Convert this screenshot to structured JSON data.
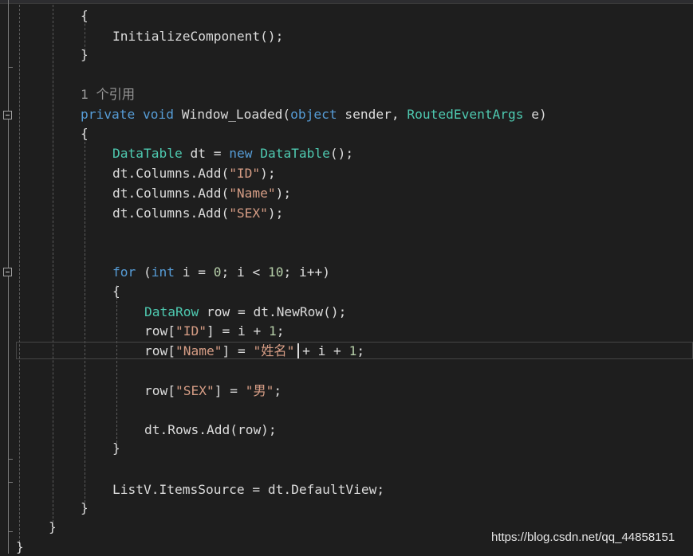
{
  "editor": {
    "lines": [
      {
        "id": "l1",
        "tokens": [
          {
            "t": "{",
            "c": "pl"
          }
        ]
      },
      {
        "id": "l2",
        "tokens": [
          {
            "t": "InitializeComponent();",
            "c": "pl"
          }
        ]
      },
      {
        "id": "l3",
        "tokens": [
          {
            "t": "}",
            "c": "pl"
          }
        ]
      },
      {
        "id": "ref",
        "tokens": [
          {
            "t": "1 个引用",
            "c": "rf"
          }
        ]
      },
      {
        "id": "l5",
        "tokens": [
          {
            "t": "private",
            "c": "kw"
          },
          {
            "t": " ",
            "c": "pl"
          },
          {
            "t": "void",
            "c": "kw"
          },
          {
            "t": " Window_Loaded(",
            "c": "pl"
          },
          {
            "t": "object",
            "c": "kw"
          },
          {
            "t": " sender, ",
            "c": "pl"
          },
          {
            "t": "RoutedEventArgs",
            "c": "ty"
          },
          {
            "t": " e)",
            "c": "pl"
          }
        ]
      },
      {
        "id": "l6",
        "tokens": [
          {
            "t": "{",
            "c": "pl"
          }
        ]
      },
      {
        "id": "l7",
        "tokens": [
          {
            "t": "DataTable",
            "c": "ty"
          },
          {
            "t": " dt = ",
            "c": "pl"
          },
          {
            "t": "new",
            "c": "kw"
          },
          {
            "t": " ",
            "c": "pl"
          },
          {
            "t": "DataTable",
            "c": "ty"
          },
          {
            "t": "();",
            "c": "pl"
          }
        ]
      },
      {
        "id": "l8",
        "tokens": [
          {
            "t": "dt.Columns.Add(",
            "c": "pl"
          },
          {
            "t": "\"ID\"",
            "c": "st"
          },
          {
            "t": ");",
            "c": "pl"
          }
        ]
      },
      {
        "id": "l9",
        "tokens": [
          {
            "t": "dt.Columns.Add(",
            "c": "pl"
          },
          {
            "t": "\"Name\"",
            "c": "st"
          },
          {
            "t": ");",
            "c": "pl"
          }
        ]
      },
      {
        "id": "l10",
        "tokens": [
          {
            "t": "dt.Columns.Add(",
            "c": "pl"
          },
          {
            "t": "\"SEX\"",
            "c": "st"
          },
          {
            "t": ");",
            "c": "pl"
          }
        ]
      },
      {
        "id": "l11",
        "tokens": [
          {
            "t": "for",
            "c": "kw"
          },
          {
            "t": " (",
            "c": "pl"
          },
          {
            "t": "int",
            "c": "kw"
          },
          {
            "t": " i = ",
            "c": "pl"
          },
          {
            "t": "0",
            "c": "nm"
          },
          {
            "t": "; i < ",
            "c": "pl"
          },
          {
            "t": "10",
            "c": "nm"
          },
          {
            "t": "; i++)",
            "c": "pl"
          }
        ]
      },
      {
        "id": "l12",
        "tokens": [
          {
            "t": "{",
            "c": "pl"
          }
        ]
      },
      {
        "id": "l13",
        "tokens": [
          {
            "t": "DataRow",
            "c": "ty"
          },
          {
            "t": " row = dt.NewRow();",
            "c": "pl"
          }
        ]
      },
      {
        "id": "l14",
        "tokens": [
          {
            "t": "row[",
            "c": "pl"
          },
          {
            "t": "\"ID\"",
            "c": "st"
          },
          {
            "t": "] = i + ",
            "c": "pl"
          },
          {
            "t": "1",
            "c": "nm"
          },
          {
            "t": ";",
            "c": "pl"
          }
        ]
      },
      {
        "id": "l15",
        "tokens": [
          {
            "t": "row[",
            "c": "pl"
          },
          {
            "t": "\"Name\"",
            "c": "st"
          },
          {
            "t": "] = ",
            "c": "pl"
          },
          {
            "t": "\"姓名\"",
            "c": "st"
          },
          {
            "t": " + i + ",
            "c": "pl"
          },
          {
            "t": "1",
            "c": "nm"
          },
          {
            "t": ";",
            "c": "pl"
          }
        ]
      },
      {
        "id": "l16",
        "tokens": [
          {
            "t": "row[",
            "c": "pl"
          },
          {
            "t": "\"SEX\"",
            "c": "st"
          },
          {
            "t": "] = ",
            "c": "pl"
          },
          {
            "t": "\"男\"",
            "c": "st"
          },
          {
            "t": ";",
            "c": "pl"
          }
        ]
      },
      {
        "id": "l17",
        "tokens": [
          {
            "t": "dt.Rows.Add(row);",
            "c": "pl"
          }
        ]
      },
      {
        "id": "l18",
        "tokens": [
          {
            "t": "}",
            "c": "pl"
          }
        ]
      },
      {
        "id": "l19",
        "tokens": [
          {
            "t": "ListV.ItemsSource = dt.DefaultView;",
            "c": "pl"
          }
        ]
      },
      {
        "id": "l20",
        "tokens": [
          {
            "t": "}",
            "c": "pl"
          }
        ]
      },
      {
        "id": "l21",
        "tokens": [
          {
            "t": "}",
            "c": "pl"
          }
        ]
      },
      {
        "id": "l22",
        "tokens": [
          {
            "t": "}",
            "c": "pl"
          }
        ]
      }
    ]
  },
  "watermark": "https://blog.csdn.net/qq_44858151",
  "colors": {
    "background": "#1e1e1e",
    "keyword": "#569cd6",
    "type": "#4ec9b0",
    "string": "#d69d85",
    "number": "#b5cea8",
    "plain": "#dcdcdc",
    "reference": "#999999"
  }
}
